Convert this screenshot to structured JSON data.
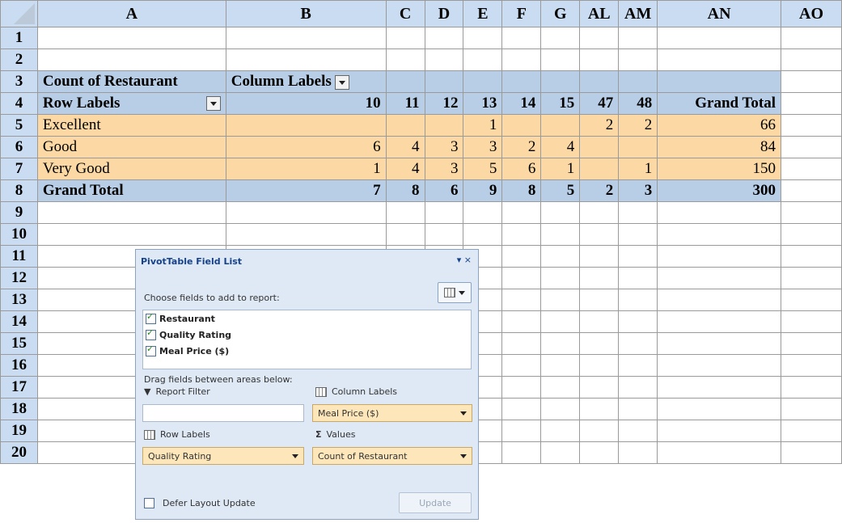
{
  "columns": [
    "A",
    "B",
    "C",
    "D",
    "E",
    "F",
    "G",
    "AL",
    "AM",
    "AN",
    "AO"
  ],
  "rows": [
    "1",
    "2",
    "3",
    "4",
    "5",
    "6",
    "7",
    "8",
    "9",
    "10",
    "11",
    "12",
    "13",
    "14",
    "15",
    "16",
    "17",
    "18",
    "19",
    "20"
  ],
  "pivot": {
    "count_label": "Count of Restaurant",
    "column_labels": "Column Labels",
    "row_labels": "Row Labels",
    "headers": [
      "10",
      "11",
      "12",
      "13",
      "14",
      "15",
      "47",
      "48"
    ],
    "grand_total_label": "Grand Total",
    "data_rows": [
      {
        "label": "Excellent",
        "values": [
          "",
          "",
          "",
          "1",
          "",
          "",
          "2",
          "2"
        ],
        "total": "66"
      },
      {
        "label": "Good",
        "values": [
          "6",
          "4",
          "3",
          "3",
          "2",
          "4",
          "",
          ""
        ],
        "total": "84"
      },
      {
        "label": "Very Good",
        "values": [
          "1",
          "4",
          "3",
          "5",
          "6",
          "1",
          "",
          "1"
        ],
        "total": "150"
      }
    ],
    "grand_total_row": {
      "values": [
        "7",
        "8",
        "6",
        "9",
        "8",
        "5",
        "2",
        "3"
      ],
      "total": "300"
    }
  },
  "field_list": {
    "title": "PivotTable Field List",
    "choose_label": "Choose fields to add to report:",
    "fields": [
      {
        "name": "Restaurant",
        "checked": true
      },
      {
        "name": "Quality Rating",
        "checked": true
      },
      {
        "name": "Meal Price ($)",
        "checked": true
      }
    ],
    "drag_label": "Drag fields between areas below:",
    "report_filter_label": "Report Filter",
    "column_labels_label": "Column Labels",
    "column_field": "Meal Price ($)",
    "row_labels_label": "Row Labels",
    "values_label": "Values",
    "row_field": "Quality Rating",
    "values_field": "Count of Restaurant",
    "defer_label": "Defer Layout Update",
    "update_label": "Update",
    "close_glyph": "▾ ×"
  }
}
